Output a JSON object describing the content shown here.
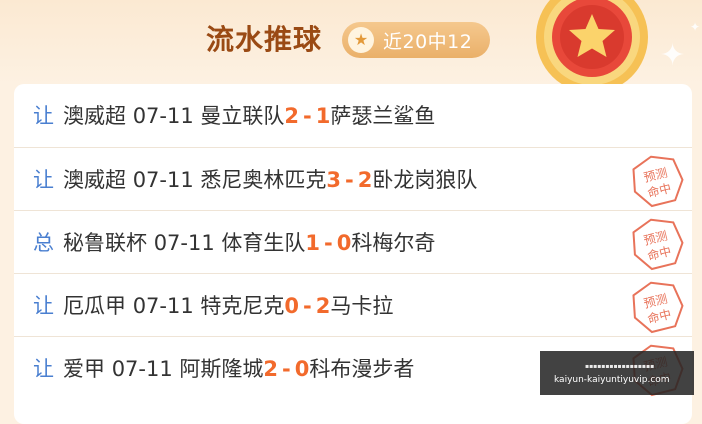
{
  "header": {
    "title": "流水推球",
    "record_label": "近20中12"
  },
  "rows": [
    {
      "tag": "让",
      "league": "澳威超",
      "date": "07-11",
      "home": "曼立联队",
      "home_score": "2",
      "away_score": "1",
      "away": "萨瑟兰鲨鱼",
      "stamp": false
    },
    {
      "tag": "让",
      "league": "澳威超",
      "date": "07-11",
      "home": "悉尼奥林匹克",
      "home_score": "3",
      "away_score": "2",
      "away": "卧龙岗狼队",
      "stamp": true
    },
    {
      "tag": "总",
      "league": "秘鲁联杯",
      "date": "07-11",
      "home": "体育生队",
      "home_score": "1",
      "away_score": "0",
      "away": "科梅尔奇",
      "stamp": true
    },
    {
      "tag": "让",
      "league": "厄瓜甲",
      "date": "07-11",
      "home": "特克尼克",
      "home_score": "0",
      "away_score": "2",
      "away": "马卡拉",
      "stamp": true
    },
    {
      "tag": "让",
      "league": "爱甲",
      "date": "07-11",
      "home": "阿斯隆城",
      "home_score": "2",
      "away_score": "0",
      "away": "科布漫步者",
      "stamp": true
    }
  ],
  "stamp_text": {
    "line1": "预测",
    "line2": "命中"
  },
  "watermark": {
    "url": "kaiyun-kaiyuntiyuvip.com"
  },
  "colors": {
    "accent": "#f26a2c",
    "tag": "#4a7fd0",
    "title": "#9a4a14",
    "stamp": "#e8735a"
  }
}
